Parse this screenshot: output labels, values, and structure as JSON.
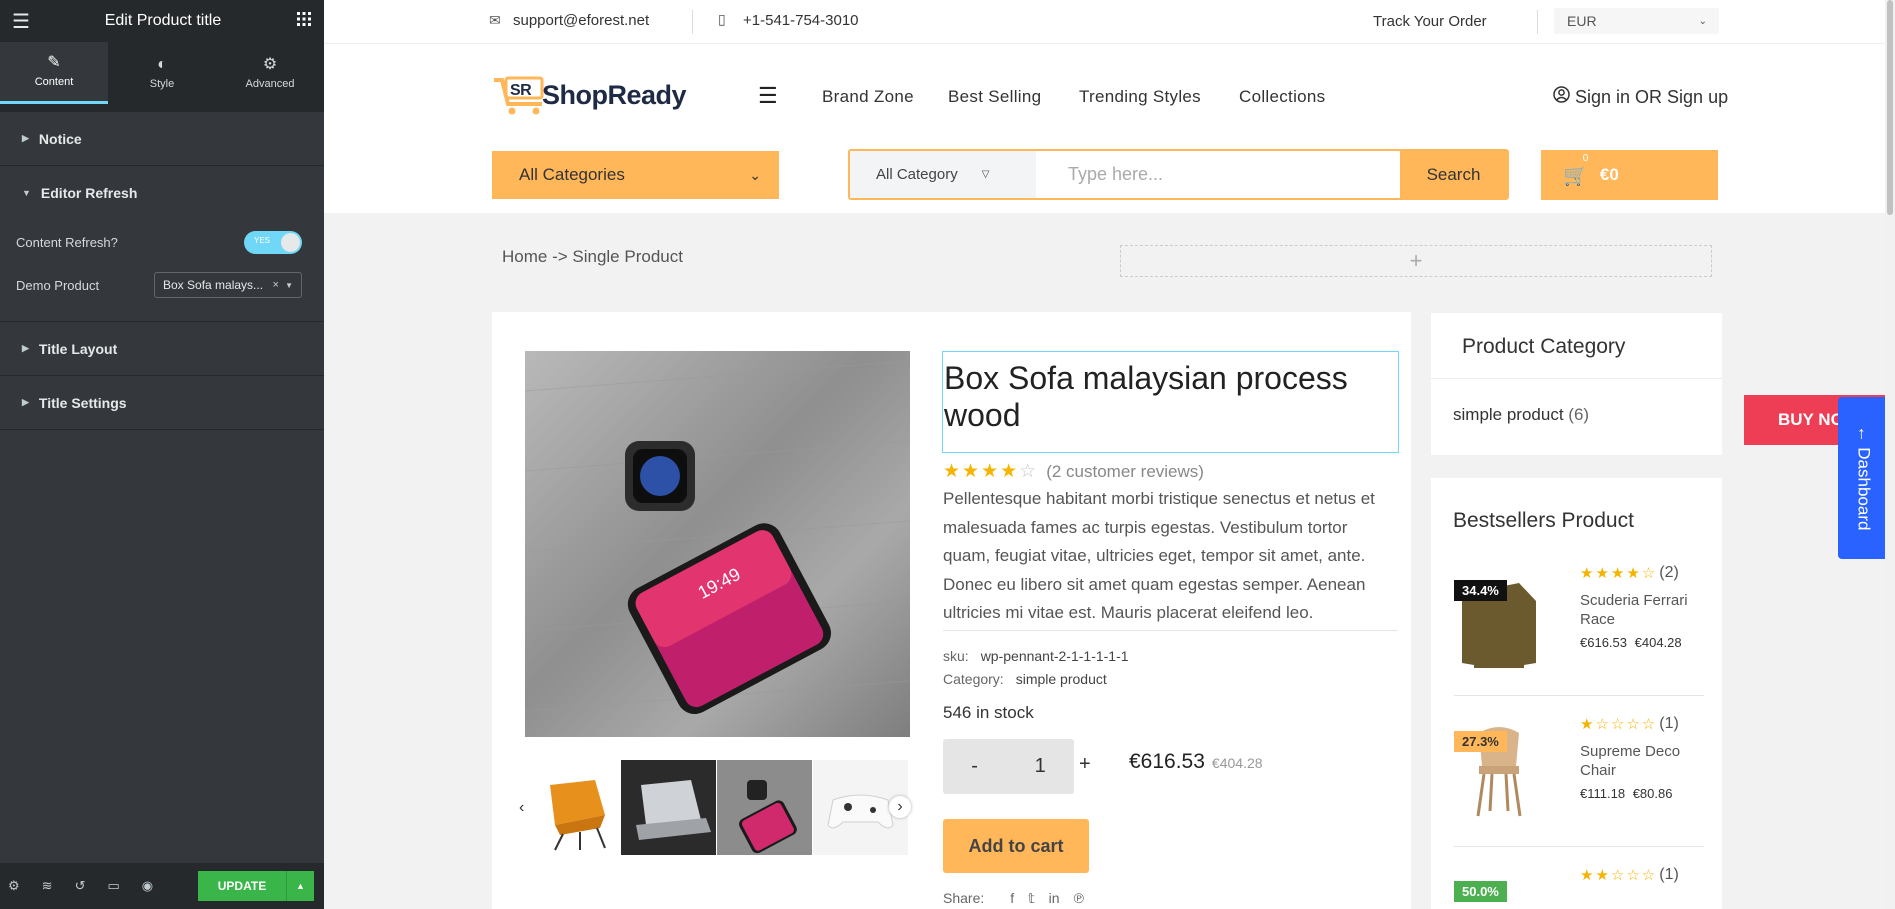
{
  "panel": {
    "title": "Edit Product title",
    "tabs": [
      {
        "label": "Content",
        "icon": "pencil-icon"
      },
      {
        "label": "Style",
        "icon": "half-circle-icon"
      },
      {
        "label": "Advanced",
        "icon": "gear-icon"
      }
    ],
    "sections": {
      "notice": "Notice",
      "editor_refresh": "Editor Refresh",
      "title_layout": "Title Layout",
      "title_settings": "Title Settings"
    },
    "controls": {
      "content_refresh_label": "Content Refresh?",
      "toggle_text": "YES",
      "demo_product_label": "Demo Product",
      "demo_product_value": "Box Sofa malays..."
    },
    "footer": {
      "update_label": "UPDATE"
    }
  },
  "site": {
    "topbar": {
      "email": "support@eforest.net",
      "phone": "+1-541-754-3010",
      "track": "Track Your Order",
      "currency": "EUR"
    },
    "logo": "ShopReady",
    "nav": [
      "Brand Zone",
      "Best Selling",
      "Trending Styles",
      "Collections"
    ],
    "account": "Sign in OR Sign up",
    "all_categories": "All Categories",
    "search": {
      "category": "All Category",
      "placeholder": "Type here...",
      "button": "Search"
    },
    "cart": {
      "count": "0",
      "total": "€0"
    },
    "breadcrumb": "Home -> Single Product",
    "product": {
      "title": "Box Sofa malaysian process wood",
      "rating": 4,
      "reviews": "(2 customer reviews)",
      "description": "Pellentesque habitant morbi tristique senectus et netus et malesuada fames ac turpis egestas. Vestibulum tortor quam, feugiat vitae, ultricies eget, tempor sit amet, ante. Donec eu libero sit amet quam egestas semper. Aenean ultricies mi vitae est. Mauris placerat eleifend leo.",
      "sku_label": "sku:",
      "sku": "wp-pennant-2-1-1-1-1-1",
      "category_label": "Category:",
      "category": "simple product",
      "stock": "546 in stock",
      "qty": "1",
      "qty_minus": "-",
      "qty_plus": "+",
      "price": "€616.53",
      "old_price": "€404.28",
      "add_to_cart": "Add to cart",
      "share": "Share:"
    },
    "product_category": {
      "title": "Product Category",
      "item": "simple product",
      "count": "(6)"
    },
    "bestsellers": {
      "title": "Bestsellers Product",
      "items": [
        {
          "badge": "34.4%",
          "badge_color": "#111111",
          "name": "Scuderia Ferrari Race",
          "price": "€616.53",
          "old": "€404.28",
          "rating": 4,
          "count": "(2)"
        },
        {
          "badge": "27.3%",
          "badge_color": "#ffb75a",
          "name": "Supreme Deco Chair",
          "price": "€111.18",
          "old": "€80.86",
          "rating": 1,
          "count": "(1)"
        },
        {
          "badge": "50.0%",
          "badge_color": "#4caf50",
          "name": "",
          "price": "",
          "old": "",
          "rating": 2,
          "count": "(1)"
        }
      ]
    },
    "buy_now": "BUY NOW",
    "dashboard": "← Dashboard"
  }
}
